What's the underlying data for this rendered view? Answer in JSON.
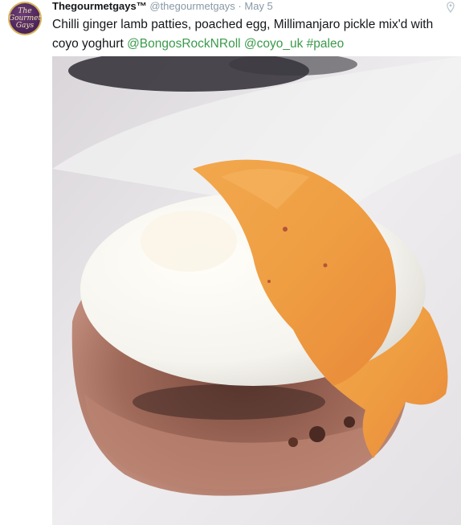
{
  "tweet": {
    "display_name": "Thegourmetgays™",
    "handle": "@thegourmetgays",
    "separator": "·",
    "date": "May 5",
    "avatar_icon": "gourmet-gays-logo",
    "location_icon": "map-pin-icon",
    "text": {
      "body": "Chilli ginger lamb patties, poached egg, Millimanjaro pickle mix'd with coyo yoghurt",
      "mention1": "@BongosRockNRoll",
      "mention2": "@coyo_uk",
      "hashtag": "#paleo"
    },
    "photo": {
      "description_icon": "food-photo"
    },
    "colors": {
      "link": "#3a9a4b",
      "meta": "#8899a6",
      "text": "#14171a",
      "sauce": "#f0a24c",
      "egg": "#f7f6f1"
    }
  }
}
